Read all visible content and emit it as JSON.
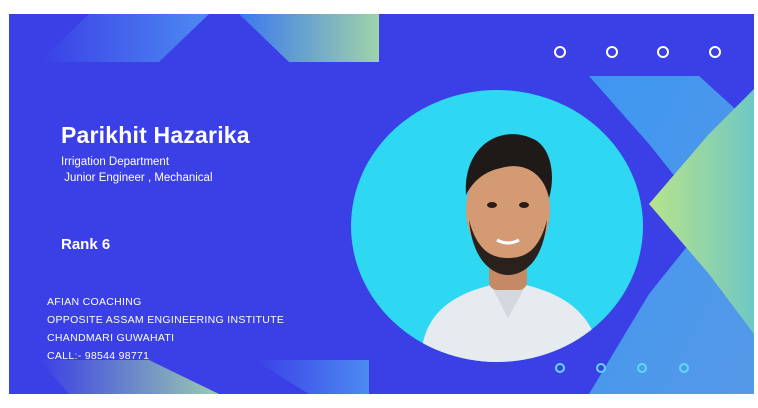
{
  "person": {
    "name": "Parikhit Hazarika",
    "department": "Irrigation Department",
    "position": " Junior Engineer , Mechanical",
    "rank": "Rank 6"
  },
  "institute": {
    "lines": [
      "AFIAN COACHING",
      "OPPOSITE ASSAM ENGINEERING INSTITUTE",
      "CHANDMARI GUWAHATI",
      "CALL:- 98544 98771"
    ]
  },
  "colors": {
    "background": "#3a3fe6",
    "photo_circle": "#2fd8f2",
    "accent_green": "#b8e38a",
    "accent_light_blue": "#4aa9f0"
  },
  "icons": [
    "ring-dot-icon"
  ]
}
